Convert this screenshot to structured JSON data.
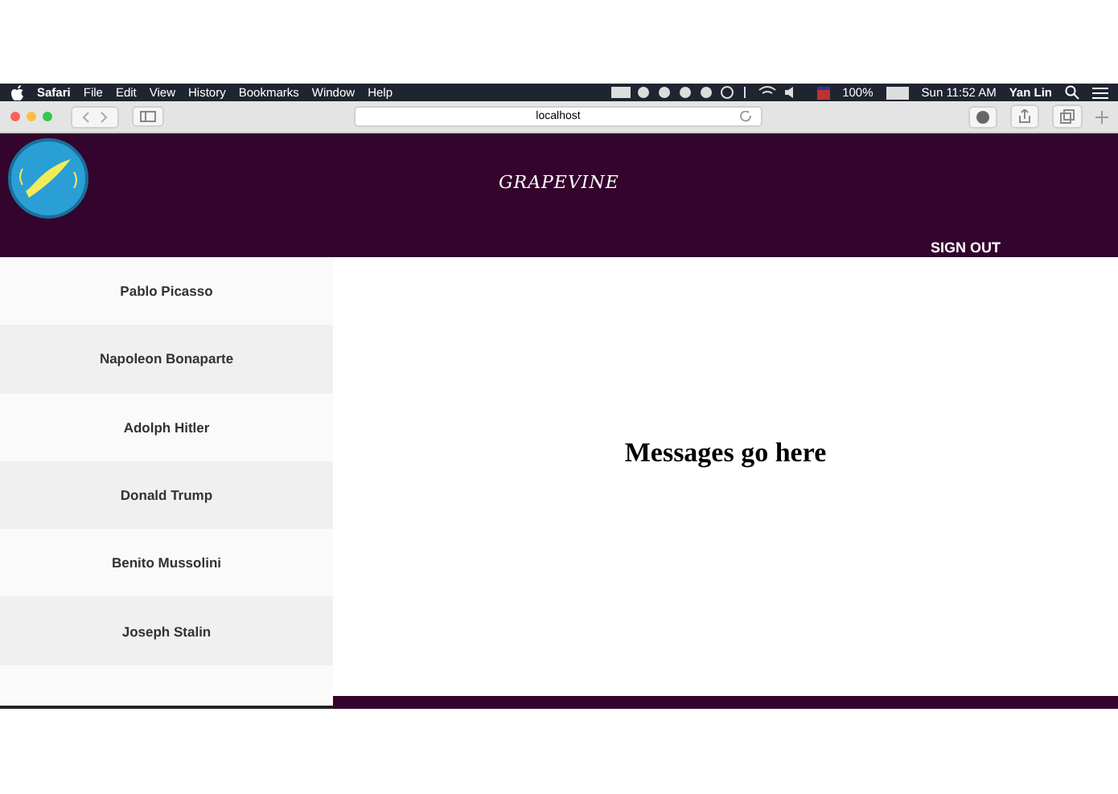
{
  "menu_bar": {
    "app": "Safari",
    "items": [
      "File",
      "Edit",
      "View",
      "History",
      "Bookmarks",
      "Window",
      "Help"
    ],
    "battery": "100%",
    "clock": "Sun 11:52 AM",
    "user": "Yan Lin"
  },
  "browser": {
    "address": "localhost"
  },
  "header": {
    "brand": "GRAPEVINE",
    "sign_out": "SIGN OUT"
  },
  "contacts": [
    {
      "name": "Pablo Picasso"
    },
    {
      "name": "Napoleon Bonaparte"
    },
    {
      "name": "Adolph Hitler"
    },
    {
      "name": "Donald Trump"
    },
    {
      "name": "Benito Mussolini"
    },
    {
      "name": "Joseph Stalin"
    }
  ],
  "messages": {
    "notice": "Messages go here"
  }
}
